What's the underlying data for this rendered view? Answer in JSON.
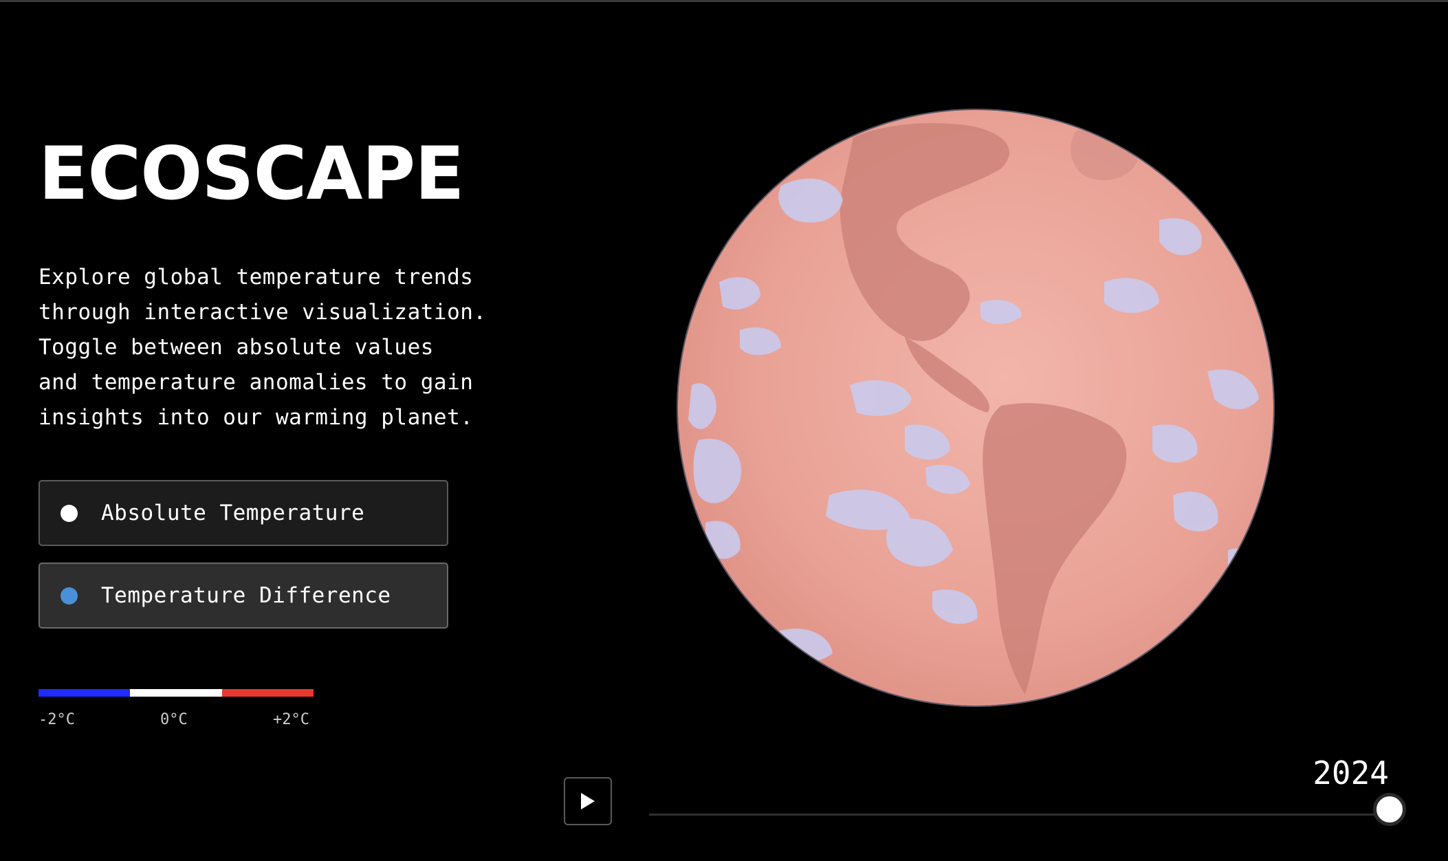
{
  "app": {
    "title": "ECOSCAPE",
    "description": "Explore global temperature trends\nthrough interactive visualization.\nToggle between absolute values\nand temperature anomalies to gain\ninsights into our warming planet."
  },
  "modes": [
    {
      "label": "Absolute Temperature",
      "dot_color": "#ffffff",
      "icon": "dot-indicator"
    },
    {
      "label": "Temperature Difference",
      "dot_color": "#4a90d9",
      "icon": "dot-indicator"
    }
  ],
  "legend": {
    "colors": [
      "#1f2bff",
      "#ffffff",
      "#e8392f"
    ],
    "labels": [
      "-2°C",
      "0°C",
      "+2°C"
    ]
  },
  "timeline": {
    "year": "2024",
    "position_fraction": 1.0,
    "play_icon": "play-icon"
  },
  "globe": {
    "base_color": "#e9a195",
    "land_color": "#c97f75",
    "cool_color": "#c8ccf2"
  }
}
